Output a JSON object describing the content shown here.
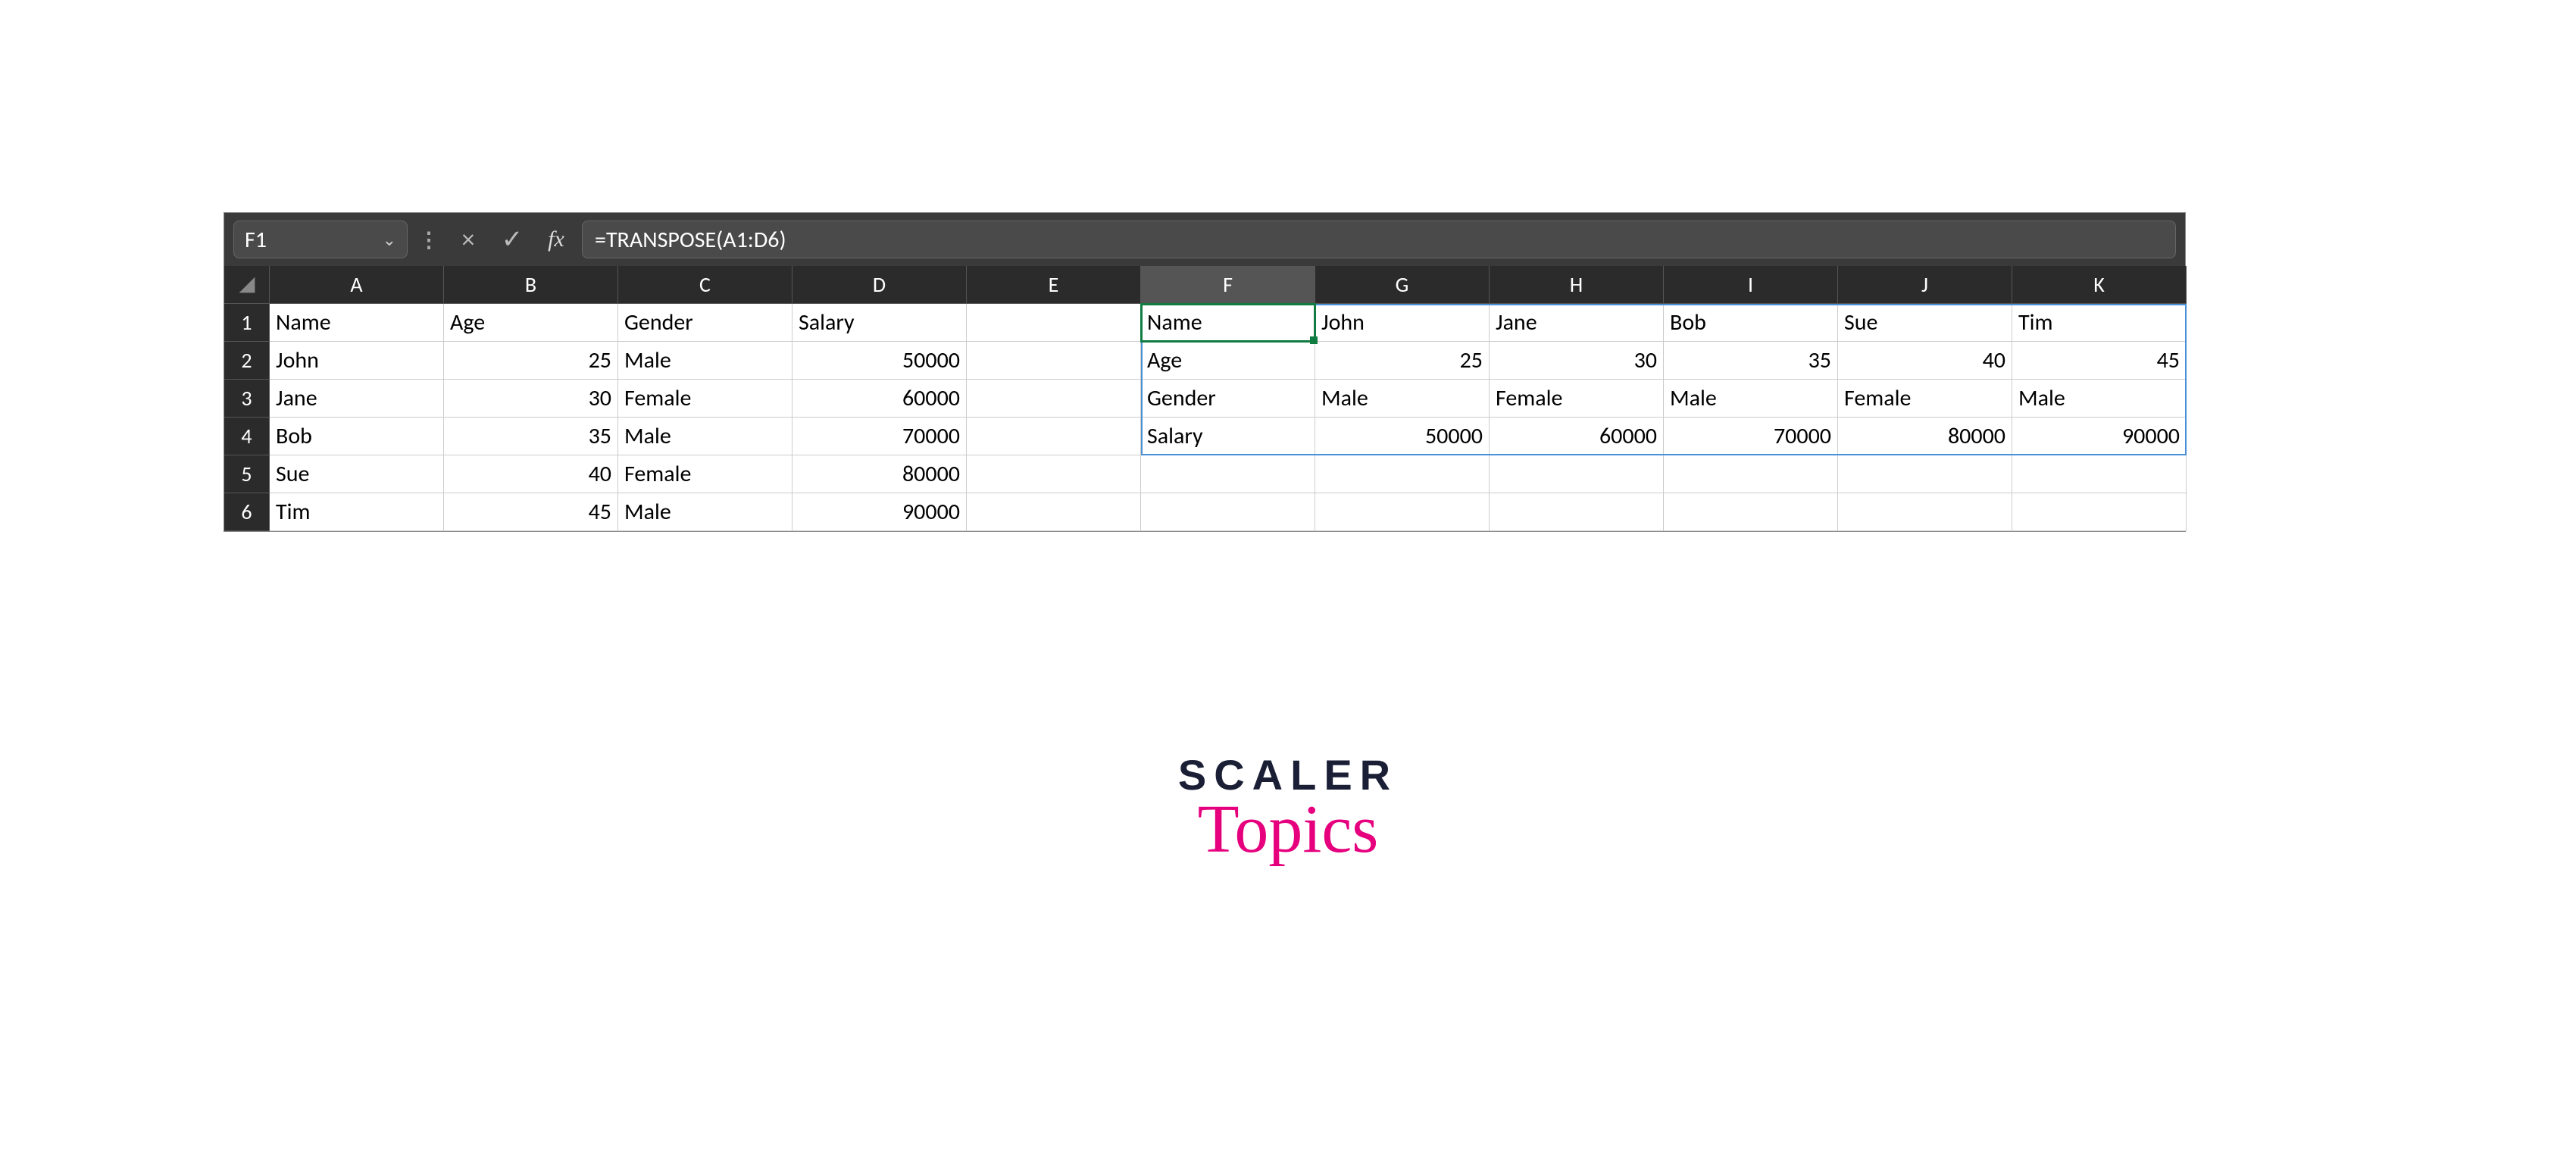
{
  "formula_bar": {
    "cell_reference": "F1",
    "formula": "=TRANSPOSE(A1:D6)"
  },
  "columns": [
    "A",
    "B",
    "C",
    "D",
    "E",
    "F",
    "G",
    "H",
    "I",
    "J",
    "K"
  ],
  "rows": [
    "1",
    "2",
    "3",
    "4",
    "5",
    "6"
  ],
  "active_cell": "F1",
  "active_column": "F",
  "spill_range": "F1:K4",
  "source_table": {
    "headers": [
      "Name",
      "Age",
      "Gender",
      "Salary"
    ],
    "data": [
      {
        "Name": "John",
        "Age": 25,
        "Gender": "Male",
        "Salary": 50000
      },
      {
        "Name": "Jane",
        "Age": 30,
        "Gender": "Female",
        "Salary": 60000
      },
      {
        "Name": "Bob",
        "Age": 35,
        "Gender": "Male",
        "Salary": 70000
      },
      {
        "Name": "Sue",
        "Age": 40,
        "Gender": "Female",
        "Salary": 80000
      },
      {
        "Name": "Tim",
        "Age": 45,
        "Gender": "Male",
        "Salary": 90000
      }
    ]
  },
  "transposed_table": {
    "rows": [
      [
        "Name",
        "John",
        "Jane",
        "Bob",
        "Sue",
        "Tim"
      ],
      [
        "Age",
        25,
        30,
        35,
        40,
        45
      ],
      [
        "Gender",
        "Male",
        "Female",
        "Male",
        "Female",
        "Male"
      ],
      [
        "Salary",
        50000,
        60000,
        70000,
        80000,
        90000
      ]
    ]
  },
  "cells": {
    "A1": "Name",
    "B1": "Age",
    "C1": "Gender",
    "D1": "Salary",
    "A2": "John",
    "B2": 25,
    "C2": "Male",
    "D2": 50000,
    "A3": "Jane",
    "B3": 30,
    "C3": "Female",
    "D3": 60000,
    "A4": "Bob",
    "B4": 35,
    "C4": "Male",
    "D4": 70000,
    "A5": "Sue",
    "B5": 40,
    "C5": "Female",
    "D5": 80000,
    "A6": "Tim",
    "B6": 45,
    "C6": "Male",
    "D6": 90000,
    "F1": "Name",
    "G1": "John",
    "H1": "Jane",
    "I1": "Bob",
    "J1": "Sue",
    "K1": "Tim",
    "F2": "Age",
    "G2": 25,
    "H2": 30,
    "I2": 35,
    "J2": 40,
    "K2": 45,
    "F3": "Gender",
    "G3": "Male",
    "H3": "Female",
    "I3": "Male",
    "J3": "Female",
    "K3": "Male",
    "F4": "Salary",
    "G4": 50000,
    "H4": 60000,
    "I4": 70000,
    "J4": 80000,
    "K4": 90000
  },
  "logo": {
    "line1": "SCALER",
    "line2": "Topics"
  },
  "icons": {
    "cancel": "×",
    "confirm": "✓",
    "fx": "fx",
    "dropdown": "⌄",
    "separator": "⋮"
  }
}
